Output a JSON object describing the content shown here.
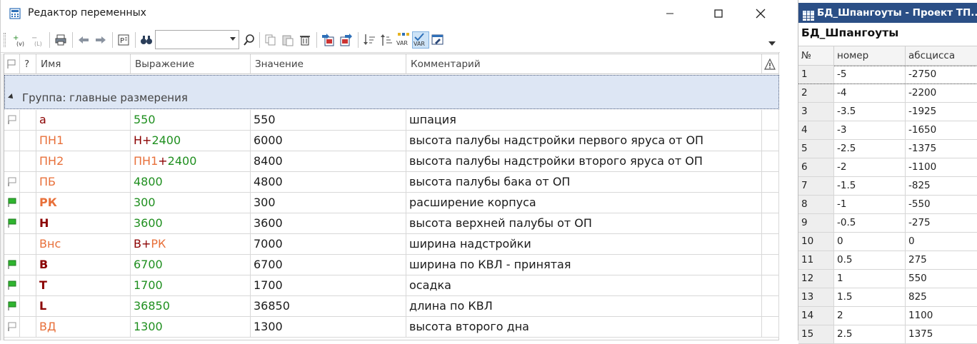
{
  "editor": {
    "title": "Редактор переменных",
    "window_buttons": {
      "minimize": "—",
      "maximize": "☐",
      "close": "✕"
    },
    "toolbar_icons": [
      "add-variable-icon",
      "delete-variable-icon",
      "print-icon",
      "undo-icon",
      "redo-icon",
      "properties-icon",
      "find-icon",
      "search-icon",
      "copy-icon",
      "paste-icon",
      "trash-icon",
      "import-icon",
      "export-icon",
      "sort-descending-icon",
      "sort-ascending-icon",
      "variables-var-icon",
      "check-var-icon",
      "settings-panel-icon"
    ],
    "search_value": "",
    "columns": {
      "flag": "",
      "question": "?",
      "name": "Имя",
      "expression": "Выражение",
      "value": "Значение",
      "comment": "Комментарий",
      "warning": "⚠"
    },
    "group": {
      "label": "Группа: главные размерения"
    },
    "rows": [
      {
        "flag": "gray",
        "name": "a",
        "name_style": "red",
        "expr": [
          {
            "t": "550",
            "c": "green"
          }
        ],
        "value": "550",
        "comment": "шпация"
      },
      {
        "flag": "none",
        "name": "ПН1",
        "name_style": "orange",
        "expr": [
          {
            "t": "Н",
            "c": "red"
          },
          {
            "t": "+",
            "c": "red"
          },
          {
            "t": "2400",
            "c": "green"
          }
        ],
        "value": "6000",
        "comment": "высота палубы надстройки первого яруса от ОП"
      },
      {
        "flag": "none",
        "name": "ПН2",
        "name_style": "orange",
        "expr": [
          {
            "t": "ПН1",
            "c": "orange"
          },
          {
            "t": "+",
            "c": "red"
          },
          {
            "t": "2400",
            "c": "green"
          }
        ],
        "value": "8400",
        "comment": "высота палубы надстройки второго яруса от ОП"
      },
      {
        "flag": "gray",
        "name": "ПБ",
        "name_style": "orange",
        "expr": [
          {
            "t": "4800",
            "c": "green"
          }
        ],
        "value": "4800",
        "comment": "высота палубы бака от ОП"
      },
      {
        "flag": "green",
        "name": "РК",
        "name_style": "orange-bold",
        "expr": [
          {
            "t": "300",
            "c": "green"
          }
        ],
        "value": "300",
        "comment": "расширение корпуса"
      },
      {
        "flag": "green",
        "name": "Н",
        "name_style": "red-bold",
        "expr": [
          {
            "t": "3600",
            "c": "green"
          }
        ],
        "value": "3600",
        "comment": "высота верхней палубы от ОП"
      },
      {
        "flag": "none",
        "name": "Внс",
        "name_style": "orange",
        "expr": [
          {
            "t": "В",
            "c": "red"
          },
          {
            "t": "+",
            "c": "red"
          },
          {
            "t": "РК",
            "c": "orange"
          }
        ],
        "value": "7000",
        "comment": "ширина надстройки"
      },
      {
        "flag": "green",
        "name": "В",
        "name_style": "red-bold",
        "expr": [
          {
            "t": "6700",
            "c": "green"
          }
        ],
        "value": "6700",
        "comment": "ширина по КВЛ - принятая"
      },
      {
        "flag": "green",
        "name": "Т",
        "name_style": "red-bold",
        "expr": [
          {
            "t": "1700",
            "c": "green"
          }
        ],
        "value": "1700",
        "comment": "осадка"
      },
      {
        "flag": "green",
        "name": "L",
        "name_style": "red-bold",
        "expr": [
          {
            "t": "36850",
            "c": "green"
          }
        ],
        "value": "36850",
        "comment": "длина по КВЛ"
      },
      {
        "flag": "gray",
        "name": "ВД",
        "name_style": "orange",
        "expr": [
          {
            "t": "1300",
            "c": "green"
          }
        ],
        "value": "1300",
        "comment": "высота второго дна"
      }
    ]
  },
  "db": {
    "title": "БД_Шпангоуты - Проект ТП...",
    "heading": "БД_Шпангоуты",
    "columns": [
      "№",
      "номер",
      "абсцисса"
    ],
    "rows": [
      [
        "1",
        "-5",
        "-2750"
      ],
      [
        "2",
        "-4",
        "-2200"
      ],
      [
        "3",
        "-3.5",
        "-1925"
      ],
      [
        "4",
        "-3",
        "-1650"
      ],
      [
        "5",
        "-2.5",
        "-1375"
      ],
      [
        "6",
        "-2",
        "-1100"
      ],
      [
        "7",
        "-1.5",
        "-825"
      ],
      [
        "8",
        "-1",
        "-550"
      ],
      [
        "9",
        "-0.5",
        "-275"
      ],
      [
        "10",
        "0",
        "0"
      ],
      [
        "11",
        "0.5",
        "275"
      ],
      [
        "12",
        "1",
        "550"
      ],
      [
        "13",
        "1.5",
        "825"
      ],
      [
        "14",
        "2",
        "1100"
      ],
      [
        "15",
        "2.5",
        "1375"
      ]
    ]
  },
  "colors": {
    "name_red": "#8b0000",
    "name_orange": "#e8703a",
    "expr_green": "#1f8f1f",
    "group_bg": "#dde6f4",
    "db_title_bg": "#2b4f86",
    "flag_green": "#2fb52f",
    "flag_gray": "#9a9a9a"
  }
}
